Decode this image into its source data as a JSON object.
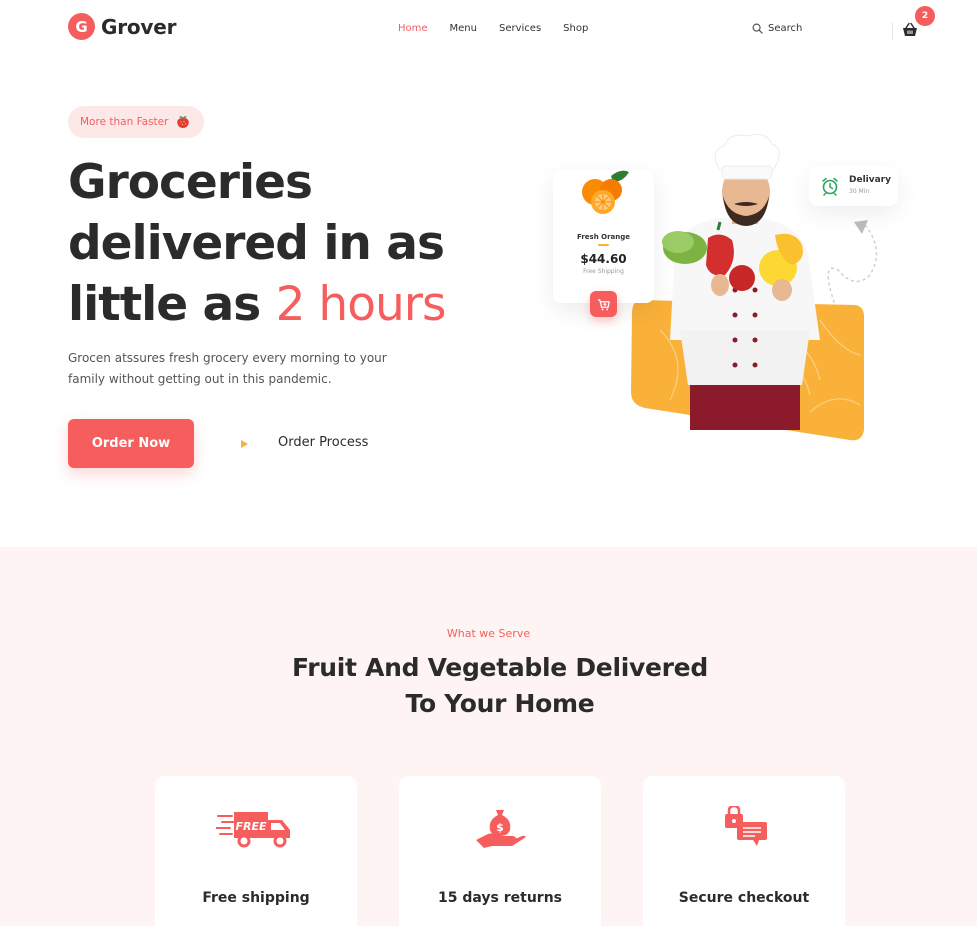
{
  "header": {
    "logo_letter": "G",
    "logo_text": "Grover",
    "nav": [
      "Home",
      "Menu",
      "Services",
      "Shop"
    ],
    "active_nav": "Home",
    "search_label": "Search",
    "cart_count": "2"
  },
  "hero": {
    "pill_text": "More than Faster",
    "title_line1": "Groceries",
    "title_line2": "delivered in as",
    "title_line3_prefix": "little as ",
    "title_line3_accent": "2 hours",
    "description": "Grocen atssures fresh grocery every morning to your family without getting out in this pandemic.",
    "order_button": "Order Now",
    "process_link": "Order Process"
  },
  "product_card": {
    "name": "Fresh Orange",
    "price": "$44.60",
    "shipping": "Free Shipping"
  },
  "delivery_card": {
    "title": "Delivary",
    "subtitle": "30 Min"
  },
  "serve": {
    "eyebrow": "What we Serve",
    "title_line1": "Fruit And Vegetable Delivered",
    "title_line2": "To Your Home",
    "features": [
      {
        "label": "Free shipping",
        "icon": "delivery-truck-icon"
      },
      {
        "label": "15 days returns",
        "icon": "money-hand-icon"
      },
      {
        "label": "Secure checkout",
        "icon": "lock-chat-icon"
      }
    ]
  },
  "colors": {
    "accent": "#f65e5e",
    "yellow": "#f9b13a",
    "section_bg": "#fff4f4",
    "dark_text": "#2b2b2b"
  }
}
